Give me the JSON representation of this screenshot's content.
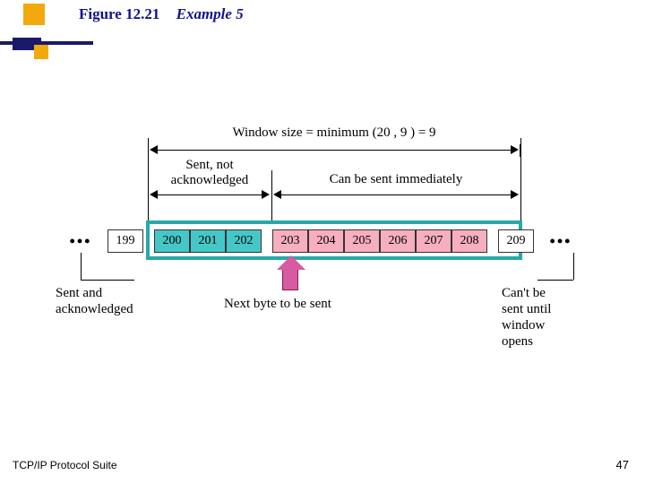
{
  "title": {
    "figure": "Figure 12.21",
    "example": "Example 5"
  },
  "window_label": "Window size = minimum (20 , 9 ) = 9",
  "seg_sent_notack": "Sent, not\nacknowledged",
  "seg_can_send": "Can be sent immediately",
  "cells": {
    "left_boundary": "199",
    "sent_unack": [
      "200",
      "201",
      "202"
    ],
    "available": [
      "203",
      "204",
      "205",
      "206",
      "207",
      "208"
    ],
    "right_boundary": "209"
  },
  "labels": {
    "sent_ack": "Sent and\nacknowledged",
    "next_byte": "Next byte to be sent",
    "cant_send": "Can't be\nsent until\nwindow\nopens"
  },
  "footer": {
    "left": "TCP/IP Protocol Suite",
    "right": "47"
  }
}
